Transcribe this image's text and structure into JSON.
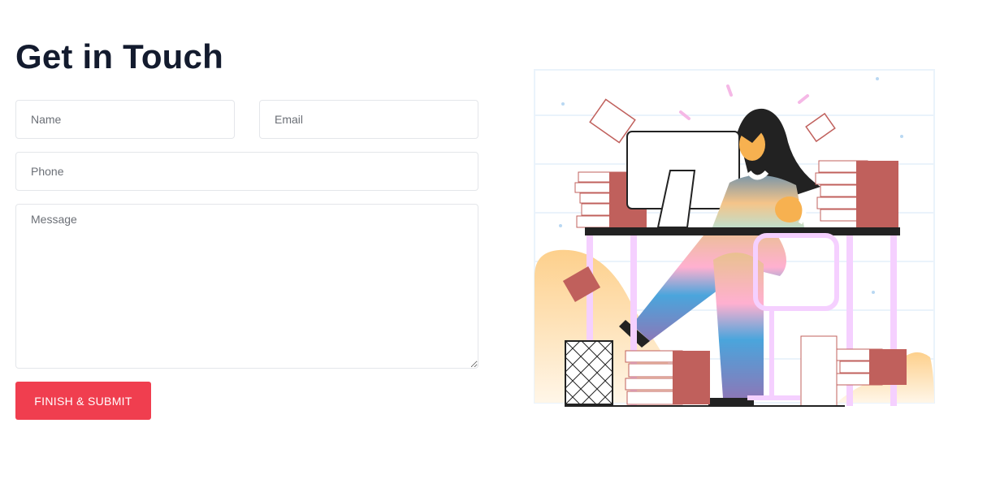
{
  "contact": {
    "title": "Get in Touch",
    "fields": {
      "name_placeholder": "Name",
      "email_placeholder": "Email",
      "phone_placeholder": "Phone",
      "message_placeholder": "Message"
    },
    "submit_label": "FINISH & SUBMIT"
  },
  "colors": {
    "accent": "#f03e4f",
    "heading": "#131b2e",
    "book": "#c0605c",
    "desk_leg": "#f5d0ff"
  },
  "illustration": {
    "subject": "woman-working-at-desk-illustration"
  }
}
